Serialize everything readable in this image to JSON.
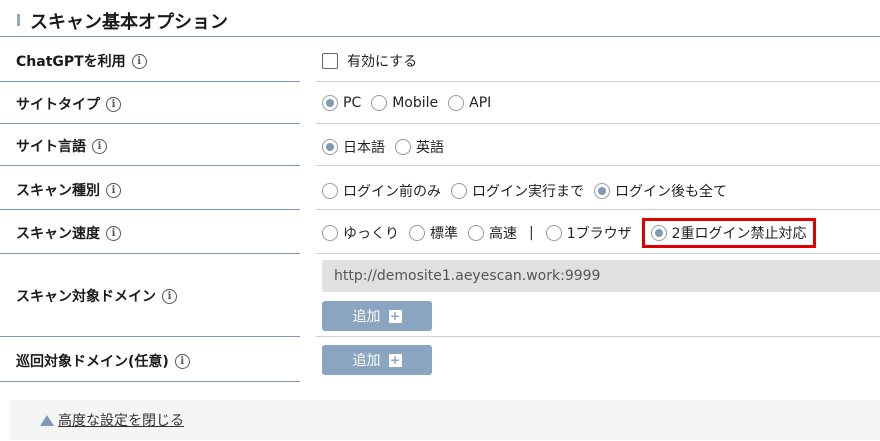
{
  "section": {
    "title": "スキャン基本オプション"
  },
  "rows": {
    "chatgpt": {
      "label": "ChatGPTを利用",
      "checkbox_label": "有効にする",
      "checked": false
    },
    "site_type": {
      "label": "サイトタイプ",
      "options": [
        "PC",
        "Mobile",
        "API"
      ],
      "selected": "PC"
    },
    "site_lang": {
      "label": "サイト言語",
      "options": [
        "日本語",
        "英語"
      ],
      "selected": "日本語"
    },
    "scan_kind": {
      "label": "スキャン種別",
      "options": [
        "ログイン前のみ",
        "ログイン実行まで",
        "ログイン後も全て"
      ],
      "selected": "ログイン後も全て"
    },
    "scan_speed": {
      "label": "スキャン速度",
      "options": [
        "ゆっくり",
        "標準",
        "高速"
      ],
      "separator": "|",
      "extra_options": [
        "1ブラウザ",
        "2重ログイン禁止対応"
      ],
      "selected": "2重ログイン禁止対応"
    },
    "target_domain": {
      "label": "スキャン対象ドメイン",
      "domain_value": "http://demosite1.aeyescan.work:9999",
      "add_label": "追加"
    },
    "crawl_domain": {
      "label": "巡回対象ドメイン(任意)",
      "add_label": "追加"
    }
  },
  "footer": {
    "link": "高度な設定を閉じる"
  },
  "colors": {
    "accent": "#7f99b3",
    "button": "#89a5c0",
    "highlight": "#e00000"
  }
}
